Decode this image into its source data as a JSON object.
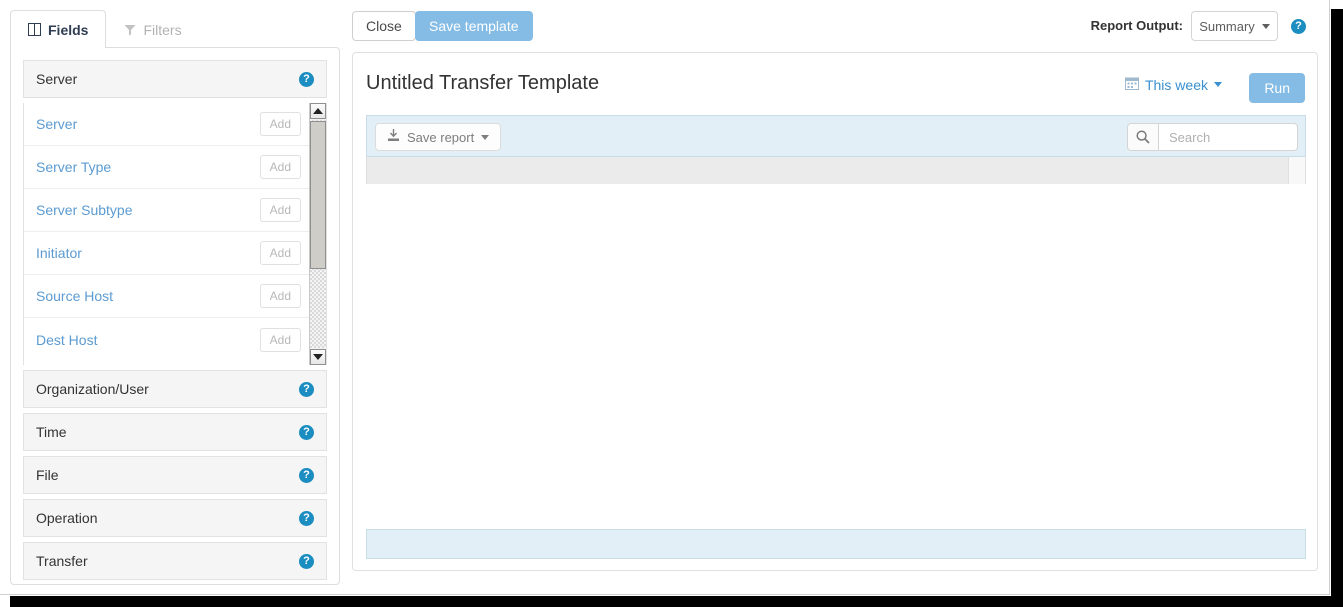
{
  "topbar": {
    "close_label": "Close",
    "save_template_label": "Save template",
    "report_output_label": "Report Output:",
    "report_output_value": "Summary",
    "help_glyph": "?",
    "help_icon": "help-circle-icon"
  },
  "left_panel": {
    "tabs": [
      {
        "label": "Fields",
        "icon": "columns-icon",
        "active": true
      },
      {
        "label": "Filters",
        "icon": "funnel-icon",
        "active": false
      }
    ],
    "sections": [
      {
        "label": "Server",
        "expanded": true,
        "help_glyph": "?"
      },
      {
        "label": "Organization/User",
        "expanded": false,
        "help_glyph": "?"
      },
      {
        "label": "Time",
        "expanded": false,
        "help_glyph": "?"
      },
      {
        "label": "File",
        "expanded": false,
        "help_glyph": "?"
      },
      {
        "label": "Operation",
        "expanded": false,
        "help_glyph": "?"
      },
      {
        "label": "Transfer",
        "expanded": false,
        "help_glyph": "?"
      }
    ],
    "fields": [
      {
        "label": "Server",
        "add_label": "Add"
      },
      {
        "label": "Server Type",
        "add_label": "Add"
      },
      {
        "label": "Server Subtype",
        "add_label": "Add"
      },
      {
        "label": "Initiator",
        "add_label": "Add"
      },
      {
        "label": "Source Host",
        "add_label": "Add"
      },
      {
        "label": "Dest Host",
        "add_label": "Add"
      }
    ],
    "scrollbar": {
      "up_icon": "scroll-up-arrow-icon",
      "down_icon": "scroll-down-arrow-icon"
    }
  },
  "right_panel": {
    "report_title": "Untitled Transfer Template",
    "date_range_label": "This week",
    "date_range_icon": "calendar-icon",
    "run_label": "Run",
    "save_report_label": "Save report",
    "save_report_icon": "download-icon",
    "search_placeholder": "Search",
    "search_value": "",
    "search_icon": "search-icon"
  },
  "colors": {
    "accent_blue": "#85bce5",
    "link_blue": "#3a90d0",
    "field_blue": "#5b9bd1",
    "toolbar_blue": "#e3eff6",
    "help_blue": "#1b8dc0",
    "section_gray": "#f5f5f5",
    "table_head_gray": "#ebebeb"
  }
}
